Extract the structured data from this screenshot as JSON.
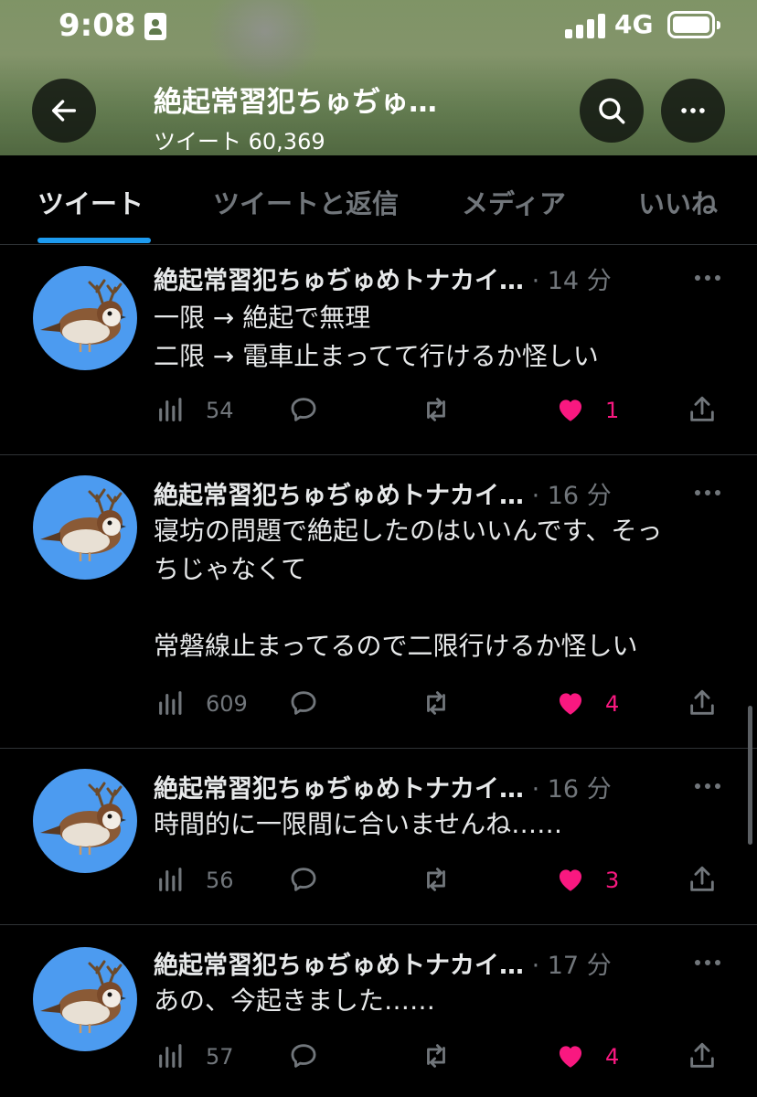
{
  "status_bar": {
    "time": "9:08",
    "network": "4G"
  },
  "header": {
    "name": "絶起常習犯ちゅぢゅ…",
    "tweet_count": "ツイート 60,369"
  },
  "tabs": [
    {
      "label": "ツイート",
      "active": true
    },
    {
      "label": "ツイートと返信",
      "active": false
    },
    {
      "label": "メディア",
      "active": false
    },
    {
      "label": "いいね",
      "active": false
    }
  ],
  "tweets": [
    {
      "name": "絶起常習犯ちゅぢゅめトナカイ…",
      "time": "· 14 分",
      "text": "一限 → 絶起で無理\n二限 → 電車止まってて行けるか怪しい",
      "views": "54",
      "likes": "1"
    },
    {
      "name": "絶起常習犯ちゅぢゅめトナカイ…",
      "time": "· 16 分",
      "text": "寝坊の問題で絶起したのはいいんです、そっ\nちじゃなくて\n\n常磐線止まってるので二限行けるか怪しい",
      "views": "609",
      "likes": "4"
    },
    {
      "name": "絶起常習犯ちゅぢゅめトナカイ…",
      "time": "· 16 分",
      "text": "時間的に一限間に合いませんね……",
      "views": "56",
      "likes": "3"
    },
    {
      "name": "絶起常習犯ちゅぢゅめトナカイ…",
      "time": "· 17 分",
      "text": "あの、今起きました……",
      "views": "57",
      "likes": "4"
    }
  ],
  "colors": {
    "accent": "#1d9bf0",
    "like": "#f91880",
    "muted": "#71767b",
    "avatar_bg": "#4c9bf0"
  }
}
